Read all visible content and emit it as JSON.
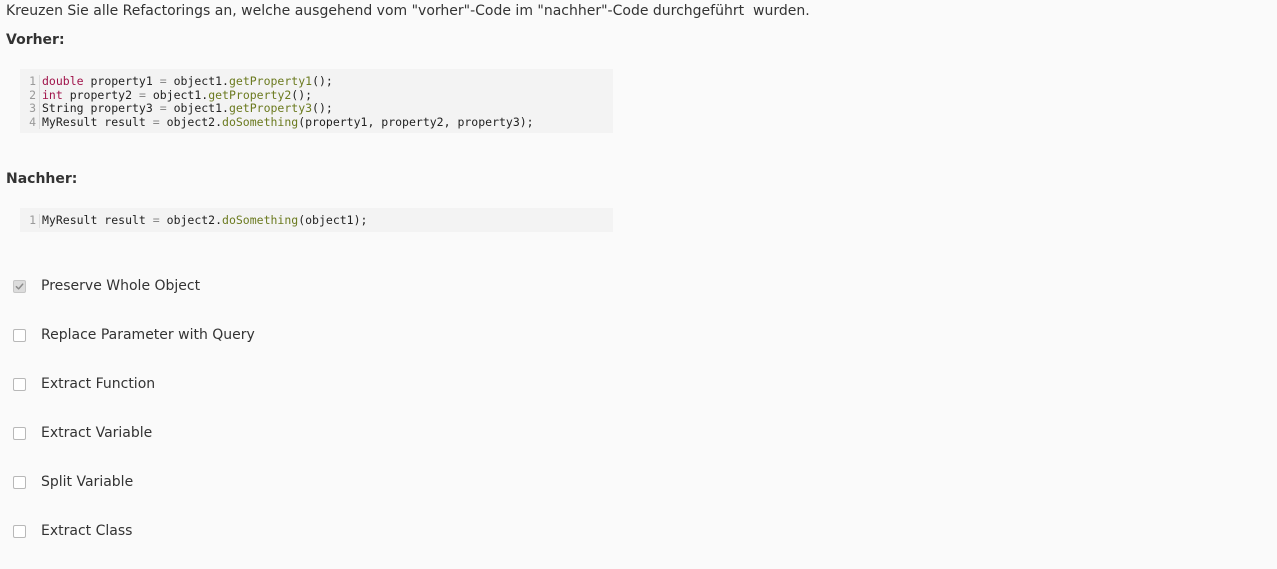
{
  "question": "Kreuzen Sie alle Refactorings an, welche ausgehend vom \"vorher\"-Code im \"nachher\"-Code durchgeführt  wurden.",
  "before": {
    "label": "Vorher:",
    "lines": [
      {
        "number": "1",
        "tokens": [
          {
            "text": "double",
            "type": "kw"
          },
          {
            "text": " property1 ",
            "type": "id"
          },
          {
            "text": "=",
            "type": "op"
          },
          {
            "text": " object1.",
            "type": "id"
          },
          {
            "text": "getProperty1",
            "type": "fn"
          },
          {
            "text": "();",
            "type": "id"
          }
        ]
      },
      {
        "number": "2",
        "tokens": [
          {
            "text": "int",
            "type": "kw"
          },
          {
            "text": " property2 ",
            "type": "id"
          },
          {
            "text": "=",
            "type": "op"
          },
          {
            "text": " object1.",
            "type": "id"
          },
          {
            "text": "getProperty2",
            "type": "fn"
          },
          {
            "text": "();",
            "type": "id"
          }
        ]
      },
      {
        "number": "3",
        "tokens": [
          {
            "text": "String property3 ",
            "type": "id"
          },
          {
            "text": "=",
            "type": "op"
          },
          {
            "text": " object1.",
            "type": "id"
          },
          {
            "text": "getProperty3",
            "type": "fn"
          },
          {
            "text": "();",
            "type": "id"
          }
        ]
      },
      {
        "number": "4",
        "tokens": [
          {
            "text": "MyResult result ",
            "type": "id"
          },
          {
            "text": "=",
            "type": "op"
          },
          {
            "text": " object2.",
            "type": "id"
          },
          {
            "text": "doSomething",
            "type": "fn"
          },
          {
            "text": "(property1, property2, property3);",
            "type": "id"
          }
        ]
      }
    ]
  },
  "after": {
    "label": "Nachher:",
    "lines": [
      {
        "number": "1",
        "tokens": [
          {
            "text": "MyResult result ",
            "type": "id"
          },
          {
            "text": "=",
            "type": "op"
          },
          {
            "text": " object2.",
            "type": "id"
          },
          {
            "text": "doSomething",
            "type": "fn"
          },
          {
            "text": "(object1);",
            "type": "id"
          }
        ]
      }
    ]
  },
  "options": [
    {
      "label": "Preserve Whole Object",
      "checked": true
    },
    {
      "label": "Replace Parameter with Query",
      "checked": false
    },
    {
      "label": "Extract Function",
      "checked": false
    },
    {
      "label": "Extract Variable",
      "checked": false
    },
    {
      "label": "Split Variable",
      "checked": false
    },
    {
      "label": "Extract Class",
      "checked": false
    }
  ]
}
